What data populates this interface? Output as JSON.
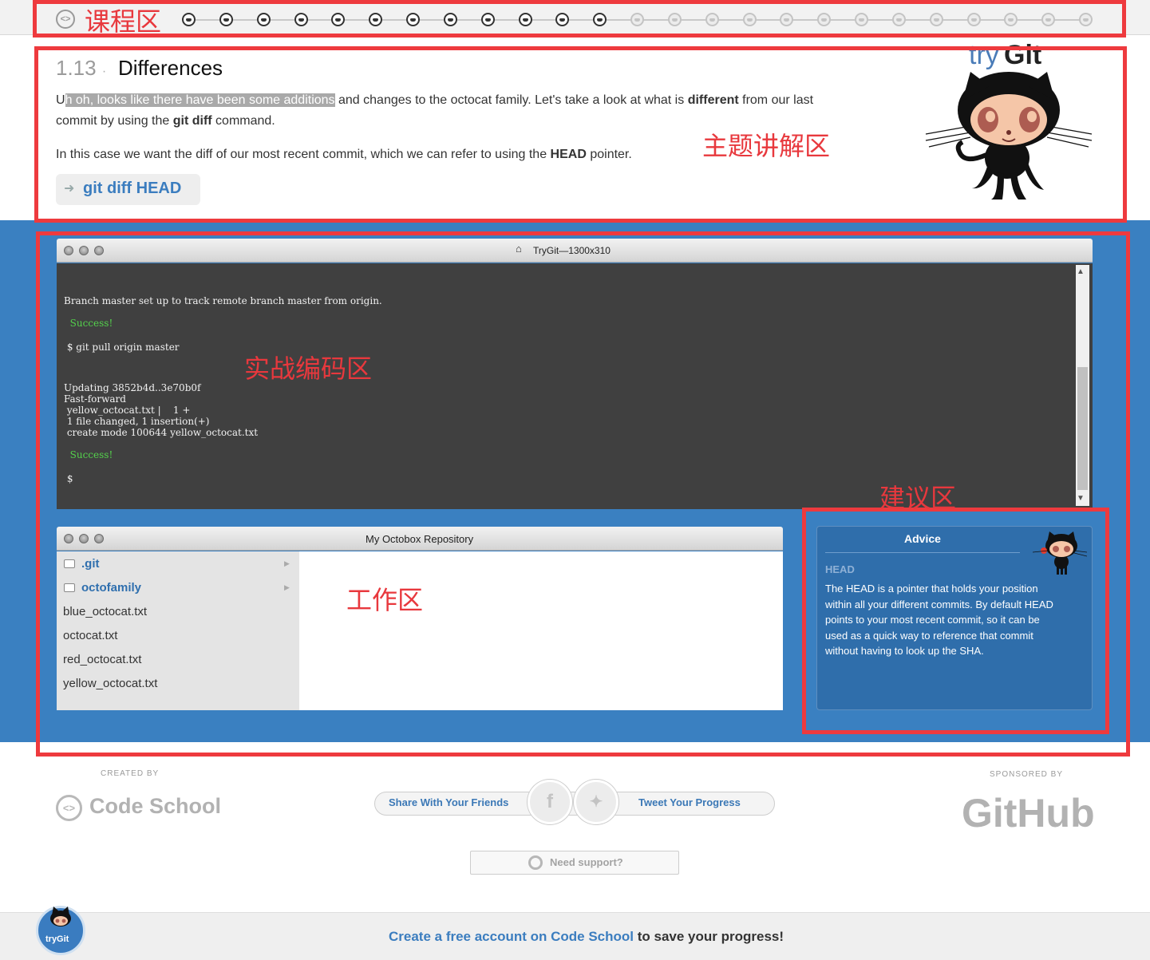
{
  "progress": {
    "completed_steps": 12,
    "total_steps": 25
  },
  "annotations": {
    "course_area": "课程区",
    "topic_area": "主题讲解区",
    "coding_area": "实战编码区",
    "advice_area": "建议区",
    "work_area": "工作区"
  },
  "lesson": {
    "number": "1.13",
    "separator": "·",
    "title": "Differences",
    "para1_highlight": "h oh, looks like there have been some additions",
    "para1_u": "U",
    "para1_a": " and changes to the octocat family. Let's take a look at what is ",
    "para1_bold1": "different",
    "para1_b": " from our last commit by using the ",
    "para1_bold2": "git diff",
    "para1_c": " command.",
    "para2_a": "In this case we want the diff of our most recent commit, which we can refer to using the ",
    "para2_bold": "HEAD",
    "para2_b": " pointer.",
    "command": "git diff HEAD"
  },
  "logo": {
    "try": "try",
    "git": "Git"
  },
  "terminal": {
    "title": "TryGit—1300x310",
    "lines": [
      "Branch master set up to track remote branch master from origin.",
      "  Success!",
      " $ git pull origin master",
      "Updating 3852b4d..3e70b0f",
      "Fast-forward",
      " yellow_octocat.txt |    1 +",
      " 1 file changed, 1 insertion(+)",
      " create mode 100644 yellow_octocat.txt",
      "  Success!",
      " $"
    ]
  },
  "repository": {
    "title": "My Octobox Repository",
    "folders": [
      ".git",
      "octofamily"
    ],
    "files": [
      "blue_octocat.txt",
      "octocat.txt",
      "red_octocat.txt",
      "yellow_octocat.txt"
    ]
  },
  "advice": {
    "title": "Advice",
    "heading": "HEAD",
    "body": "The HEAD is a pointer that holds your position within all your different commits. By default HEAD points to your most recent commit, so it can be used as a quick way to reference that commit without having to look up the SHA."
  },
  "footer": {
    "created_by": "CREATED BY",
    "code_school": "Code School",
    "share": "Share With Your Friends",
    "tweet": "Tweet Your Progress",
    "sponsored_by": "SPONSORED BY",
    "github": "GitHub",
    "support": "Need support?",
    "cta_link": "Create a free account on Code School",
    "cta_rest": " to save your progress!",
    "badge": "tryGit"
  },
  "colors": {
    "accent_blue": "#3a80c1",
    "link_blue": "#3b7dbf",
    "annotation_red": "#ee3a3e",
    "terminal_bg": "#404040",
    "success_green": "#54d24c"
  }
}
